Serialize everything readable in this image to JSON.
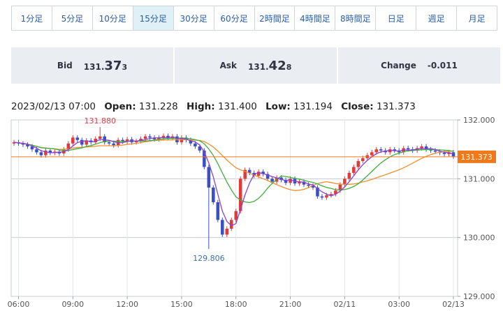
{
  "timeframes": {
    "items": [
      "1分足",
      "5分足",
      "10分足",
      "15分足",
      "30分足",
      "60分足",
      "2時間足",
      "4時間足",
      "8時間足",
      "日足",
      "週足",
      "月足"
    ],
    "active_index": 3,
    "active_bg": "#dff0f6"
  },
  "quote": {
    "bid_label": "Bid",
    "bid_prefix": "131.",
    "bid_big": "37",
    "bid_small": "3",
    "ask_label": "Ask",
    "ask_prefix": "131.",
    "ask_big": "42",
    "ask_small": "8",
    "change_label": "Change",
    "change_value": "-0.011"
  },
  "ohlc": {
    "datetime": "2023/02/13 07:00",
    "open_label": "Open:",
    "open": "131.228",
    "high_label": "High:",
    "high": "131.400",
    "low_label": "Low:",
    "low": "131.194",
    "close_label": "Close:",
    "close": "131.373"
  },
  "chart_data": {
    "type": "candlestick",
    "ylim": [
      129.0,
      132.0
    ],
    "y_ticks": [
      "132.000",
      "131.000",
      "130.000",
      "129.000"
    ],
    "x_ticks": [
      {
        "label": "06:00",
        "i": 1
      },
      {
        "label": "09:00",
        "i": 13
      },
      {
        "label": "12:00",
        "i": 25
      },
      {
        "label": "15:00",
        "i": 37
      },
      {
        "label": "18:00",
        "i": 49
      },
      {
        "label": "21:00",
        "i": 61
      },
      {
        "label": "02/11",
        "i": 73
      },
      {
        "label": "03:00",
        "i": 85
      },
      {
        "label": "02/13",
        "i": 97
      }
    ],
    "current_price": "131.373",
    "current_value": 131.373,
    "high_annotation": {
      "label": "131.880",
      "i": 19,
      "value": 131.88
    },
    "low_annotation": {
      "label": "129.806",
      "i": 43,
      "value": 129.806
    },
    "colors": {
      "up": "#e03a3a",
      "down": "#3b4fc4",
      "ma_short": "#8a3fd0",
      "ma_mid": "#3fae3a",
      "ma_long": "#f0902a",
      "price_line": "#f07a1a"
    },
    "closes": [
      131.62,
      131.6,
      131.58,
      131.55,
      131.5,
      131.45,
      131.4,
      131.48,
      131.44,
      131.46,
      131.43,
      131.5,
      131.6,
      131.7,
      131.66,
      131.58,
      131.65,
      131.62,
      131.68,
      131.72,
      131.62,
      131.6,
      131.57,
      131.66,
      131.63,
      131.67,
      131.62,
      131.64,
      131.68,
      131.72,
      131.7,
      131.67,
      131.7,
      131.73,
      131.69,
      131.72,
      131.62,
      131.7,
      131.66,
      131.6,
      131.55,
      131.48,
      131.2,
      130.85,
      130.6,
      130.3,
      130.05,
      130.15,
      130.3,
      130.45,
      131.0,
      131.15,
      131.1,
      131.05,
      131.12,
      131.08,
      131.0,
      130.95,
      131.02,
      130.98,
      130.93,
      131.0,
      130.92,
      130.95,
      130.9,
      130.88,
      130.85,
      130.7,
      130.68,
      130.72,
      130.74,
      130.8,
      130.9,
      131.0,
      131.1,
      131.2,
      131.3,
      131.35,
      131.4,
      131.45,
      131.5,
      131.48,
      131.45,
      131.5,
      131.48,
      131.45,
      131.52,
      131.5,
      131.48,
      131.52,
      131.55,
      131.5,
      131.48,
      131.46,
      131.44,
      131.42,
      131.45,
      131.38
    ]
  }
}
